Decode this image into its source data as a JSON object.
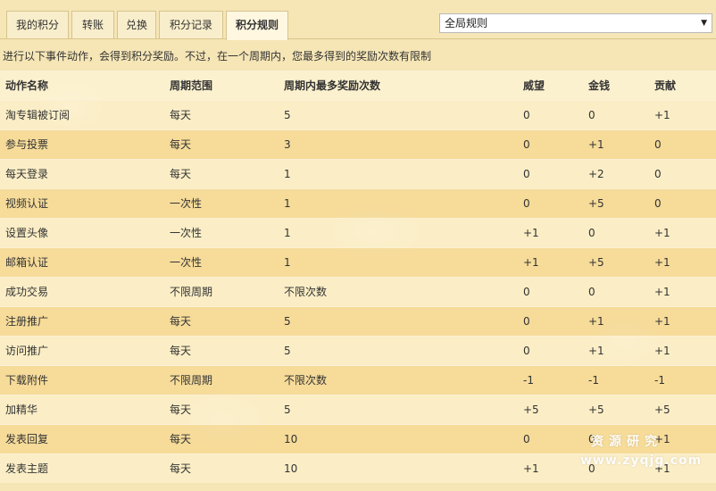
{
  "tabs": [
    {
      "label": "我的积分",
      "active": false
    },
    {
      "label": "转账",
      "active": false
    },
    {
      "label": "兑换",
      "active": false
    },
    {
      "label": "积分记录",
      "active": false
    },
    {
      "label": "积分规则",
      "active": true
    }
  ],
  "scope_select": {
    "selected": "全局规则"
  },
  "intro_text": "进行以下事件动作，会得到积分奖励。不过，在一个周期内，您最多得到的奖励次数有限制",
  "table": {
    "columns": [
      "动作名称",
      "周期范围",
      "周期内最多奖励次数",
      "威望",
      "金钱",
      "贡献"
    ],
    "rows": [
      [
        "淘专辑被订阅",
        "每天",
        "5",
        "0",
        "0",
        "+1"
      ],
      [
        "参与投票",
        "每天",
        "3",
        "0",
        "+1",
        "0"
      ],
      [
        "每天登录",
        "每天",
        "1",
        "0",
        "+2",
        "0"
      ],
      [
        "视频认证",
        "一次性",
        "1",
        "0",
        "+5",
        "0"
      ],
      [
        "设置头像",
        "一次性",
        "1",
        "+1",
        "0",
        "+1"
      ],
      [
        "邮箱认证",
        "一次性",
        "1",
        "+1",
        "+5",
        "+1"
      ],
      [
        "成功交易",
        "不限周期",
        "不限次数",
        "0",
        "0",
        "+1"
      ],
      [
        "注册推广",
        "每天",
        "5",
        "0",
        "+1",
        "+1"
      ],
      [
        "访问推广",
        "每天",
        "5",
        "0",
        "+1",
        "+1"
      ],
      [
        "下载附件",
        "不限周期",
        "不限次数",
        "-1",
        "-1",
        "-1"
      ],
      [
        "加精华",
        "每天",
        "5",
        "+5",
        "+5",
        "+5"
      ],
      [
        "发表回复",
        "每天",
        "10",
        "0",
        "0",
        "+1"
      ],
      [
        "发表主题",
        "每天",
        "10",
        "+1",
        "0",
        "+1"
      ]
    ]
  },
  "watermark": {
    "text_cn": "资源研究",
    "url": "www.zyqjg.com"
  }
}
